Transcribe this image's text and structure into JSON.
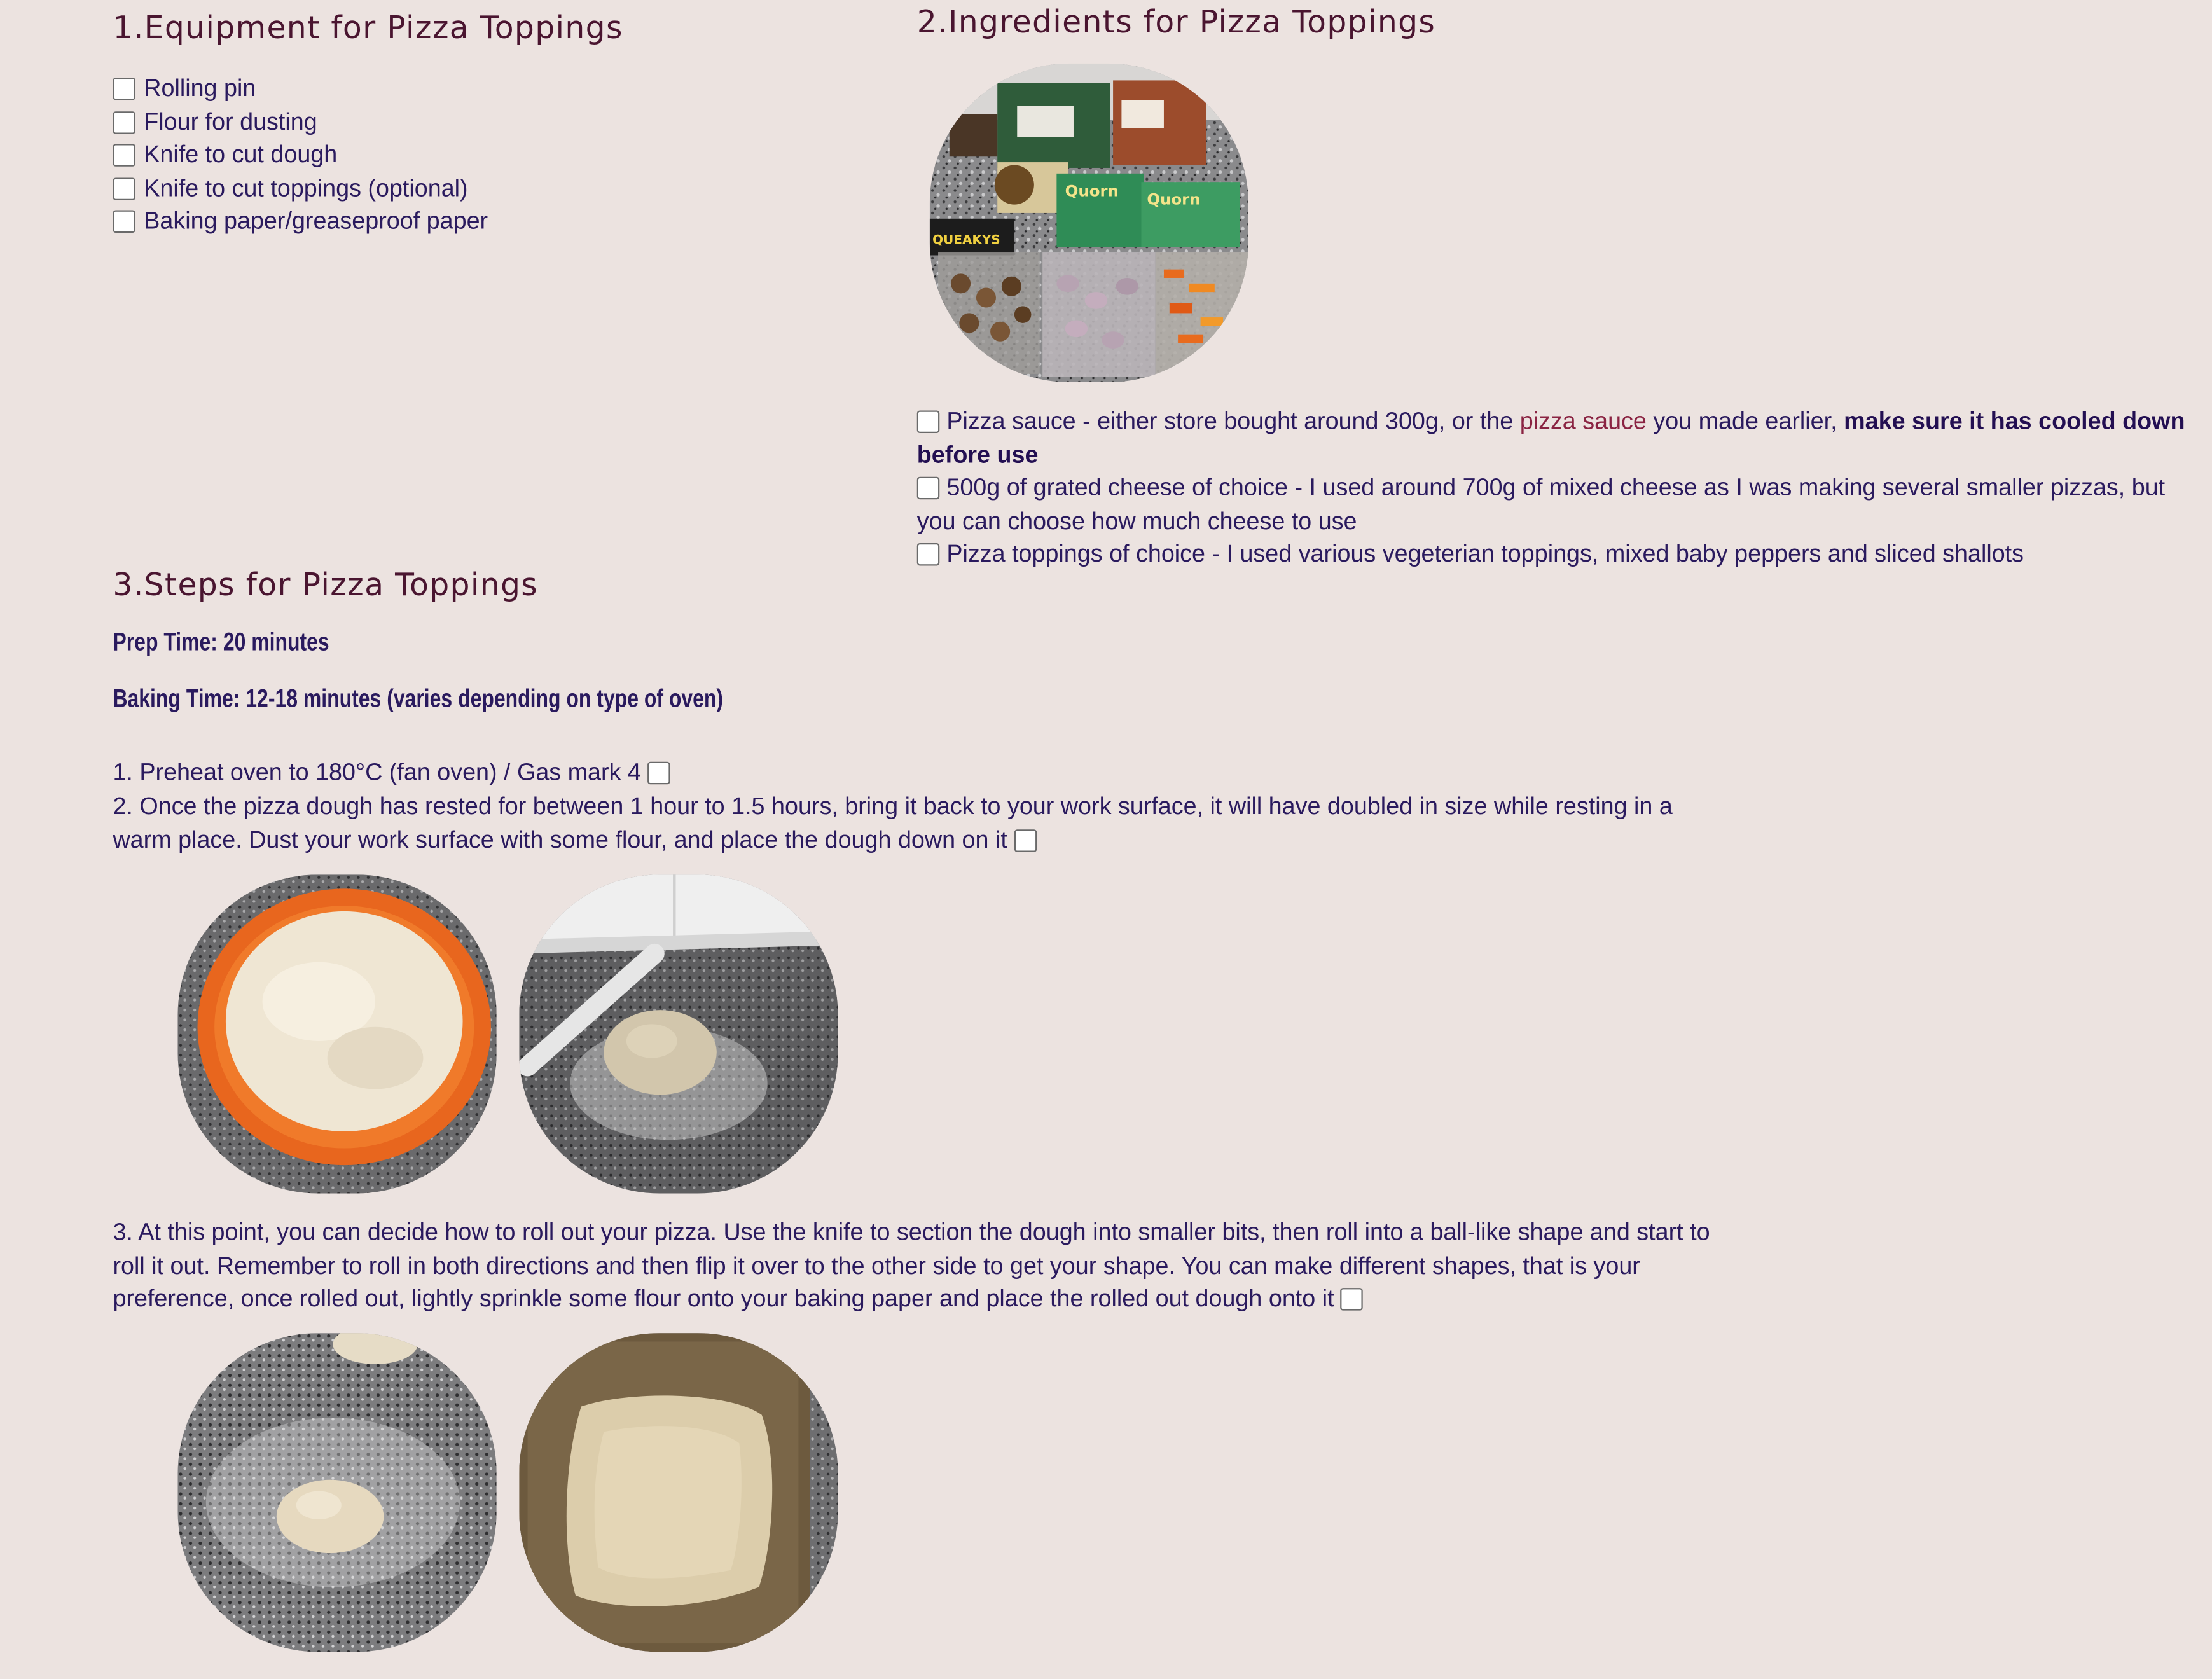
{
  "equipment": {
    "heading": "1.Equipment for Pizza Toppings",
    "items": [
      "Rolling pin",
      "Flour for dusting",
      "Knife to cut dough",
      "Knife to cut toppings (optional)",
      "Baking paper/greaseproof paper"
    ]
  },
  "ingredients": {
    "heading": "2.Ingredients for Pizza Toppings",
    "photo_label": "QUEAKYS",
    "photo_brand": "Quorn",
    "item1": {
      "before": "Pizza sauce - either store bought around 300g, or the ",
      "link": "pizza sauce",
      "after": " you made earlier, ",
      "bold": "make sure it has cooled down before use"
    },
    "item2": "500g of grated cheese of choice - I used around 700g of mixed cheese as I was making several smaller pizzas, but you can choose how much cheese to use",
    "item3": "Pizza toppings of choice - I used various vegeterian toppings, mixed baby peppers and sliced shallots"
  },
  "steps": {
    "heading": "3.Steps for Pizza Toppings",
    "prep_time": "Prep Time: 20 minutes",
    "baking_time": "Baking Time: 12-18 minutes (varies depending on type of oven)",
    "step1": "1. Preheat oven to 180°C (fan oven) / Gas mark 4",
    "step2": "2. Once the pizza dough has rested for between 1 hour to 1.5 hours, bring it back to your work surface, it will have doubled in size while resting in a warm place. Dust your work surface with some flour, and place the dough down on it",
    "step3": "3. At this point, you can decide how to roll out your pizza. Use the knife to section the dough into smaller bits, then roll into a ball-like shape and start to roll it out. Remember to roll in both directions and then flip it over to the other side to get your shape. You can make different shapes, that is your preference, once rolled out, lightly sprinkle some flour onto your baking paper and place the rolled out dough onto it"
  },
  "colors": {
    "background": "#ece3e0",
    "heading": "#4a1530",
    "text": "#2a1a5e",
    "link": "#8a2342"
  }
}
